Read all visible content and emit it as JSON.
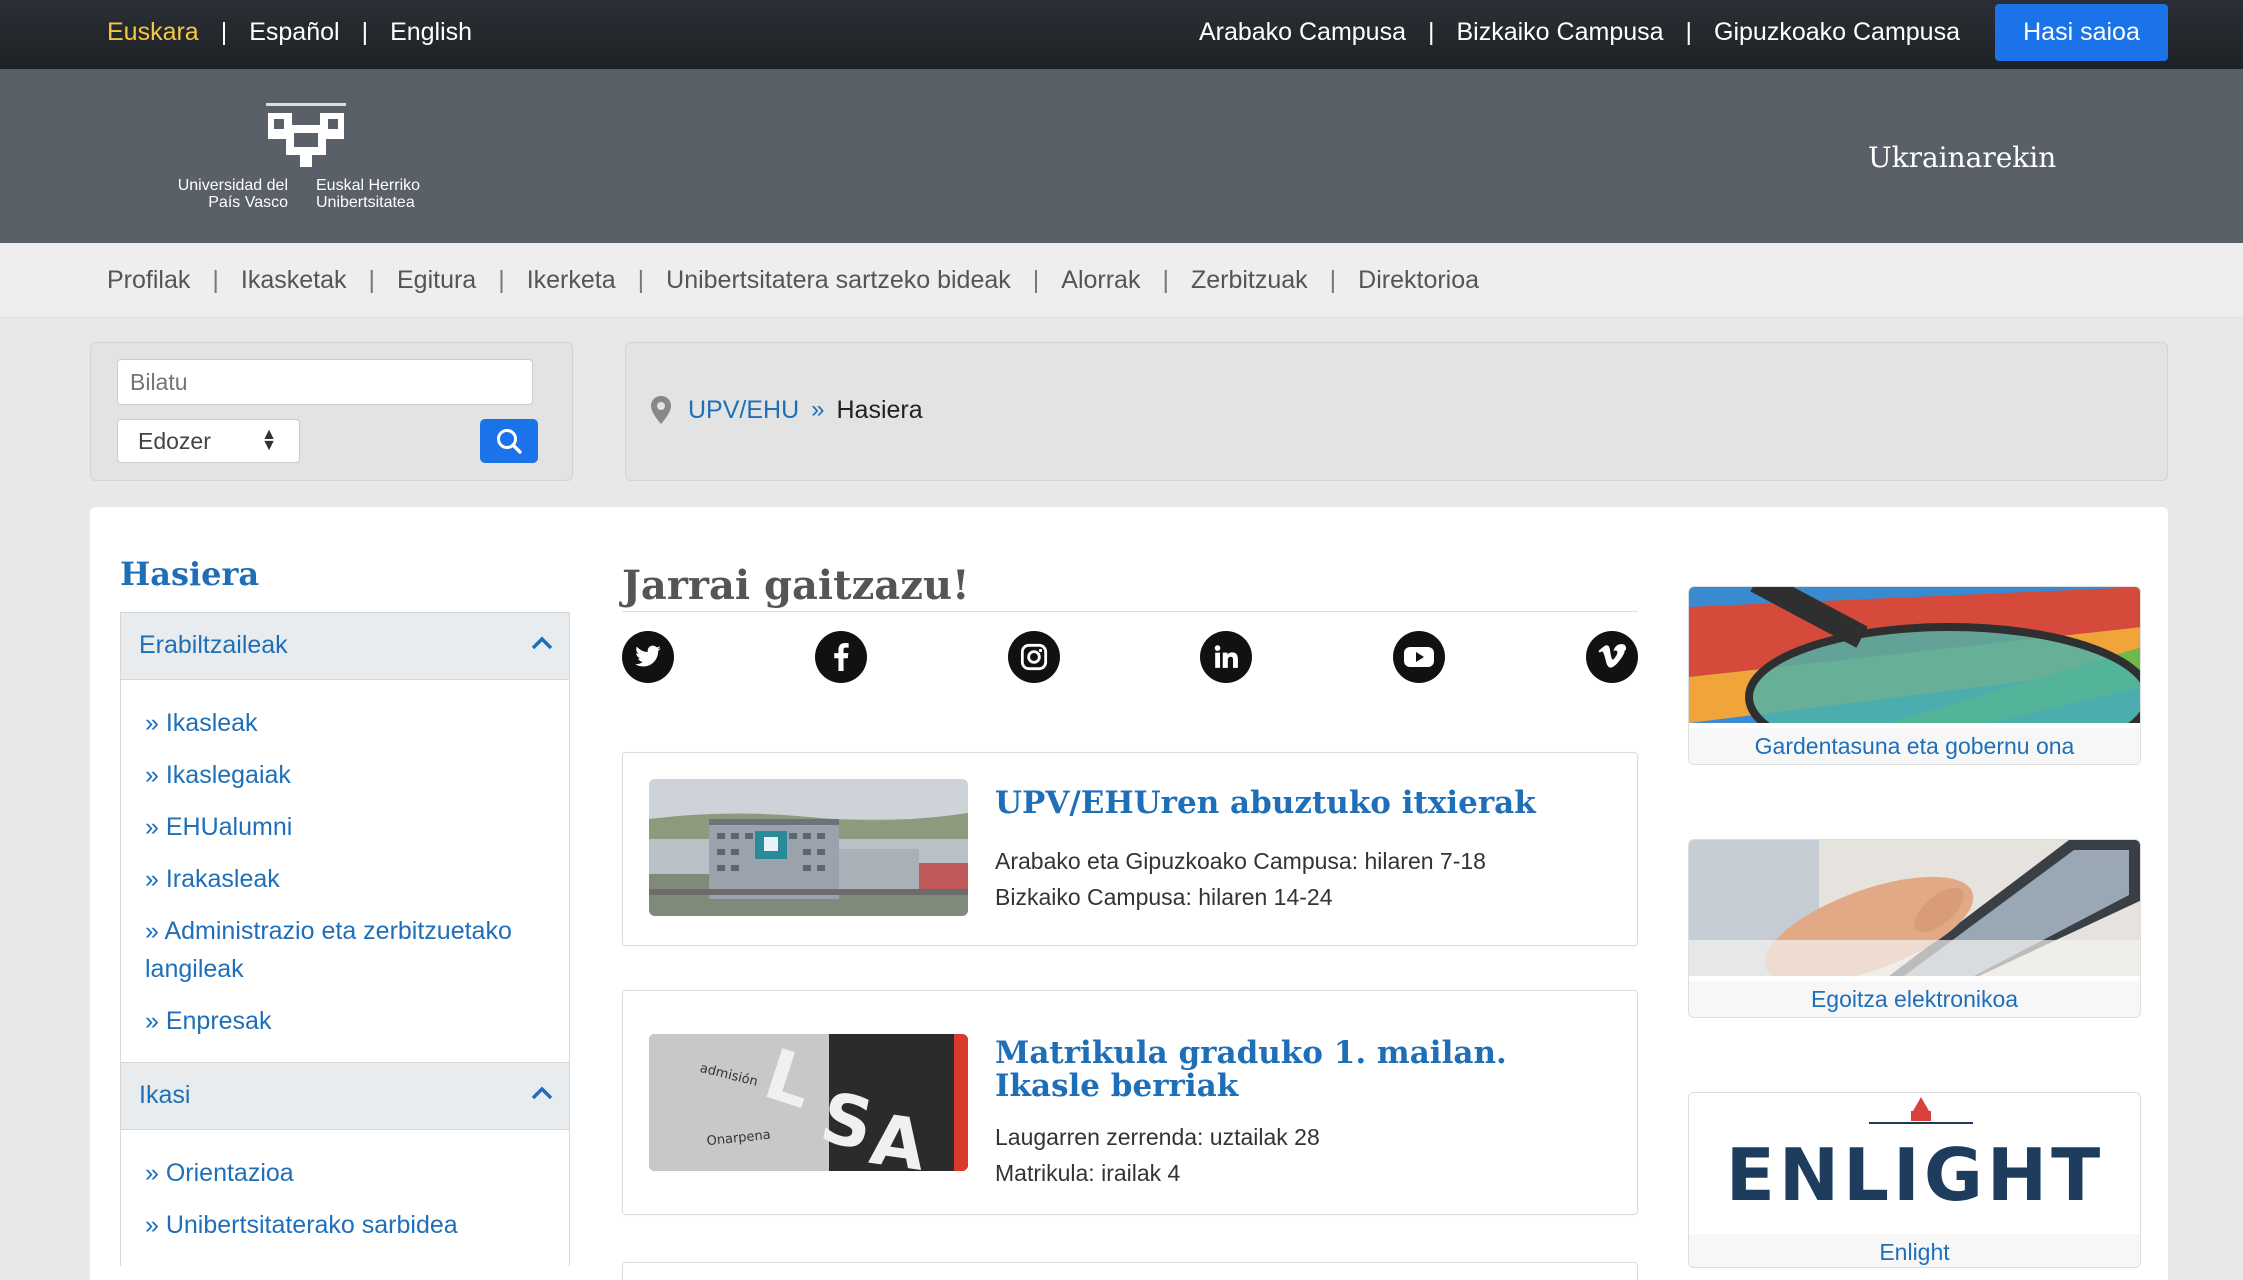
{
  "topbar": {
    "languages": [
      "Euskara",
      "Español",
      "English"
    ],
    "active_language": "Euskara",
    "campuses": [
      "Arabako Campusa",
      "Bizkaiko Campusa",
      "Gipuzkoako Campusa"
    ],
    "login_label": "Hasi saioa"
  },
  "header": {
    "logo_caption_left": "Universidad del País Vasco",
    "logo_caption_right": "Euskal Herriko Unibertsitatea",
    "ukraine_label": "Ukrainarekin"
  },
  "mainnav": {
    "items": [
      "Profilak",
      "Ikasketak",
      "Egitura",
      "Ikerketa",
      "Unibertsitatera sartzeko bideak",
      "Alorrak",
      "Zerbitzuak",
      "Direktorioa"
    ]
  },
  "search": {
    "placeholder": "Bilatu",
    "scope_value": "Edozer",
    "button_icon": "search-icon"
  },
  "breadcrumb": {
    "root": "UPV/EHU",
    "current": "Hasiera",
    "icon": "map-pin-icon"
  },
  "sidebar": {
    "title": "Hasiera",
    "sections": [
      {
        "label": "Erabiltzaileak",
        "items": [
          "» Ikasleak",
          "» Ikaslegaiak",
          "» EHUalumni",
          "» Irakasleak",
          "» Administrazio eta zerbitzuetako langileak",
          "» Enpresak"
        ]
      },
      {
        "label": "Ikasi",
        "items": [
          "» Orientazioa",
          "» Unibertsitaterako sarbidea"
        ]
      }
    ]
  },
  "follow": {
    "title": "Jarrai gaitzazu!",
    "networks": [
      "twitter-icon",
      "facebook-icon",
      "instagram-icon",
      "linkedin-icon",
      "youtube-icon",
      "vimeo-icon"
    ]
  },
  "news": [
    {
      "title": "UPV/EHUren abuztuko itxierak",
      "lines": [
        "Arabako eta Gipuzkoako Campusa: hilaren 7-18",
        "Bizkaiko Campusa: hilaren 14-24"
      ]
    },
    {
      "title": "Matrikula graduko 1. mailan. Ikasle berriak",
      "lines": [
        "Laugarren zerrenda: uztailak 28",
        "Matrikula: irailak 4"
      ],
      "image_text": [
        "admisión",
        "Onarpena"
      ]
    }
  ],
  "tiles": [
    {
      "caption": "Gardentasuna eta gobernu ona"
    },
    {
      "caption": "Egoitza elektronikoa"
    },
    {
      "caption": "Enlight",
      "logo_text": "ENLIGHT"
    }
  ],
  "colors": {
    "accent": "#1f6fb8",
    "button": "#1a73e8",
    "active_language": "#f5c842"
  }
}
